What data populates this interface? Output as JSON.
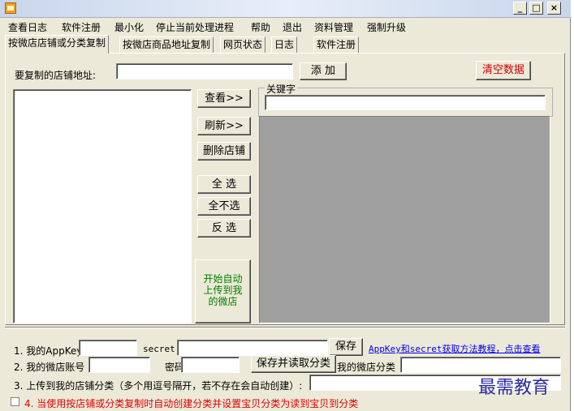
{
  "window": {
    "minimize_label": "_",
    "maximize_label": "□",
    "close_label": "×"
  },
  "menu": [
    "查看日志",
    "软件注册",
    "最小化",
    "停止当前处理进程",
    "帮助",
    "退出",
    "资料管理",
    "强制升级"
  ],
  "tabs": [
    "按微店店铺或分类复制",
    "按微店商品地址复制",
    "网页状态",
    "日志",
    "软件注册"
  ],
  "store_url": {
    "label": "要复制的店铺地址:",
    "value": ""
  },
  "buttons": {
    "add": "添  加",
    "clear_data": "清空数据",
    "view": "查看>>",
    "refresh": "刷新>>",
    "delete_store": "删除店铺",
    "select_all": "全  选",
    "select_none": "全不选",
    "invert_select": "反  选",
    "auto_upload": "开始自动上传到我的微店",
    "save": "保存",
    "save_read_category": "保存并读取分类"
  },
  "keyword": {
    "label": "关键字",
    "value": ""
  },
  "form": {
    "appkey_label": "1. 我的AppKey",
    "appkey_value": "",
    "secret_label": "secret",
    "secret_value": "",
    "appkey_help_link": "AppKey和secret获取方法教程，点击查看",
    "account_label": "2. 我的微店账号",
    "account_value": "",
    "password_label": "密码",
    "password_value": "",
    "my_category_label": "我的微店分类",
    "my_category_value": "",
    "upload_category_label": "3. 上传到我的店铺分类（多个用逗号隔开，若不存在会自动创建）:",
    "upload_category_value": "",
    "checkbox_label": "4. 当使用按店铺或分类复制时自动创建分类并设置宝贝分类为读到宝贝到分类",
    "checkbox_checked": false
  },
  "watermark": "最需教育",
  "colors": {
    "clear_button_text": "#d00000",
    "auto_upload_text": "#008000",
    "link": "#0000ee",
    "checkbox_label": "#e00000"
  }
}
